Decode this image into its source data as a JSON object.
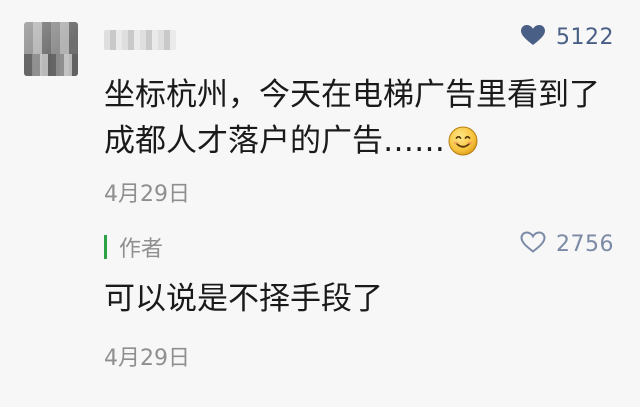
{
  "comment": {
    "like_count": "5122",
    "text_line1": "坐标杭州，今天在电梯广告里看到了",
    "text_line2": "成都人才落户的广告……",
    "emoji": "smiling-face-emoji",
    "date": "4月29日"
  },
  "author_reply": {
    "label": "作者",
    "like_count": "2756",
    "text": "可以说是不择手段了",
    "date": "4月29日"
  },
  "colors": {
    "background": "#f7f7f7",
    "like_filled": "#4a5f86",
    "like_outline": "#7b8aa6",
    "author_accent": "#2ba245",
    "date_text": "#8f8f8f"
  }
}
